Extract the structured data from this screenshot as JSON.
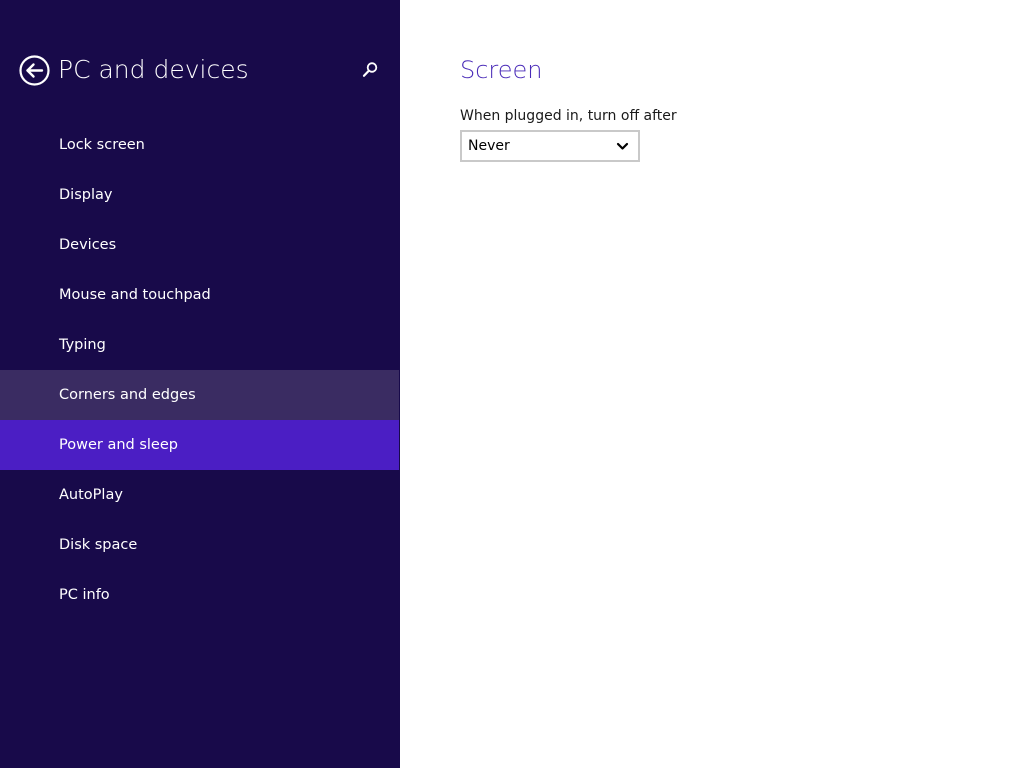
{
  "sidebar": {
    "title": "PC and devices",
    "back_icon": "back-arrow-circle-icon",
    "search_icon": "search-icon",
    "items": [
      {
        "label": "Lock screen",
        "state": "normal"
      },
      {
        "label": "Display",
        "state": "normal"
      },
      {
        "label": "Devices",
        "state": "normal"
      },
      {
        "label": "Mouse and touchpad",
        "state": "normal"
      },
      {
        "label": "Typing",
        "state": "normal"
      },
      {
        "label": "Corners and edges",
        "state": "hover"
      },
      {
        "label": "Power and sleep",
        "state": "selected"
      },
      {
        "label": "AutoPlay",
        "state": "normal"
      },
      {
        "label": "Disk space",
        "state": "normal"
      },
      {
        "label": "PC info",
        "state": "normal"
      }
    ]
  },
  "main": {
    "section_title": "Screen",
    "field_label": "When plugged in, turn off after",
    "dropdown": {
      "selected_value": "Never",
      "icon": "chevron-down-icon"
    }
  },
  "colors": {
    "sidebar_background": "#180a4a",
    "hover_background": "#3a2c62",
    "selected_background": "#4b1ec4",
    "accent_text": "#4a2bb8",
    "content_background": "#ffffff"
  }
}
